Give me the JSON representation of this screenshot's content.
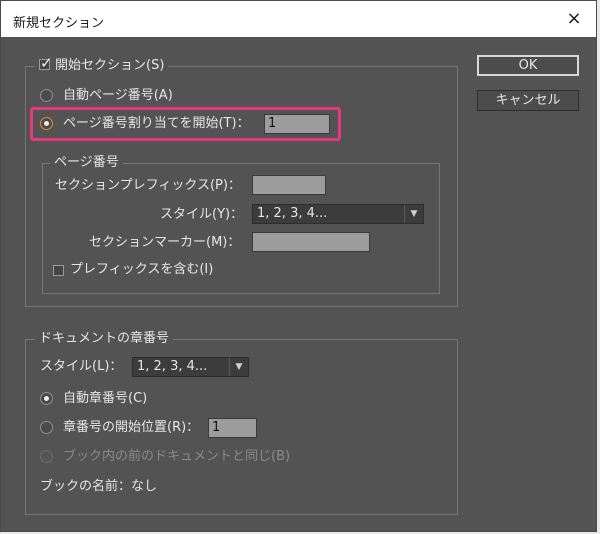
{
  "window": {
    "title": "新規セクション",
    "close_icon": "×"
  },
  "buttons": {
    "ok": "OK",
    "cancel": "キャンセル"
  },
  "start_section": {
    "checkbox_label": "開始セクション(S)",
    "checked": true,
    "auto_page_label": "自動ページ番号(A)",
    "start_page_label": "ページ番号割り当てを開始(T)：",
    "start_page_value": "1",
    "page_numbering": {
      "legend": "ページ番号",
      "prefix_label": "セクションプレフィックス(P)：",
      "prefix_value": "",
      "style_label": "スタイル(Y)：",
      "style_value": "1, 2, 3, 4...",
      "marker_label": "セクションマーカー(M)：",
      "marker_value": "",
      "include_prefix_label": "プレフィックスを含む(I)",
      "include_prefix_checked": false
    }
  },
  "chapter": {
    "legend": "ドキュメントの章番号",
    "style_label": "スタイル(L)：",
    "style_value": "1, 2, 3, 4...",
    "auto_chapter_label": "自動章番号(C)",
    "start_at_label": "章番号の開始位置(R)：",
    "start_at_value": "1",
    "same_as_prev_label": "ブック内の前のドキュメントと同じ(B)",
    "book_name_label": "ブックの名前：なし"
  },
  "colors": {
    "dialog_bg": "#535353",
    "highlight": "#e33b7a",
    "radio_accent": "#e9892f"
  }
}
